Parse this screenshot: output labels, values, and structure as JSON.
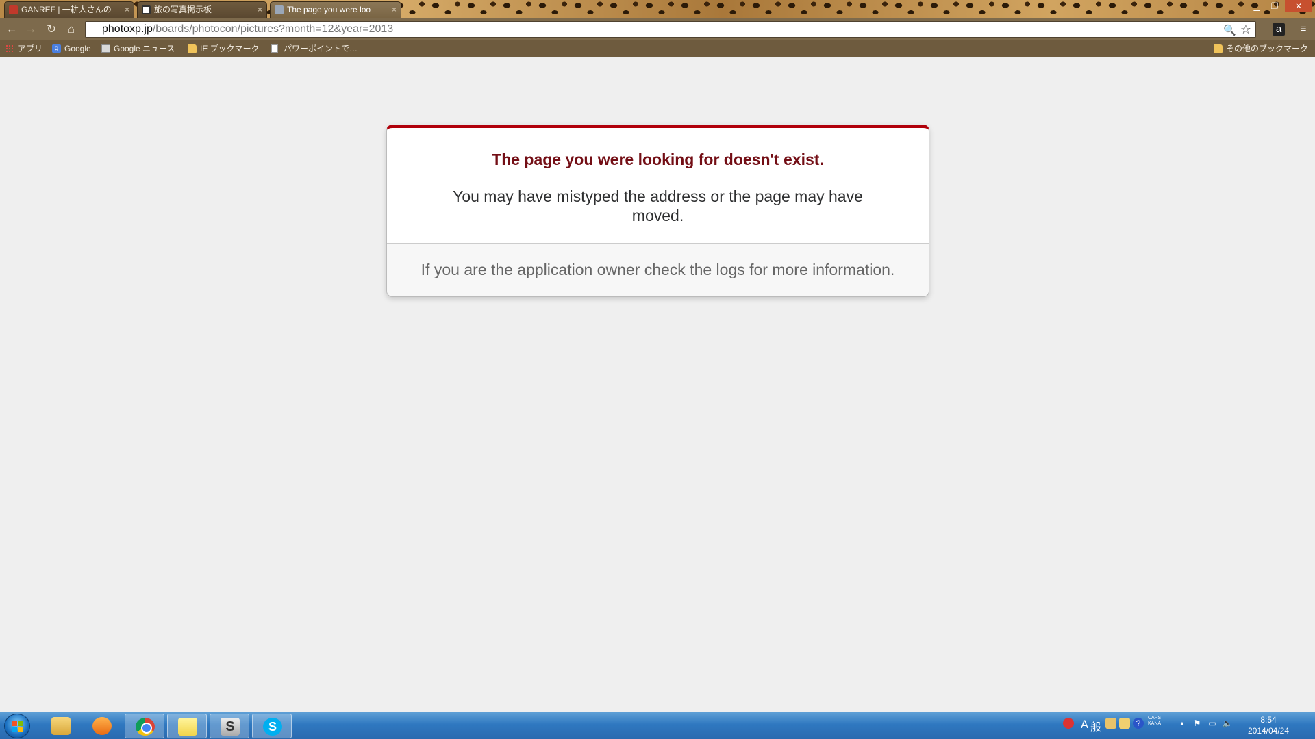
{
  "browser": {
    "tabs": [
      {
        "title": "GANREF | 一耕人さんの",
        "favicon": "camera-icon",
        "active": false
      },
      {
        "title": "旅の写真掲示板",
        "favicon": "camera-icon",
        "active": false
      },
      {
        "title": "The page you were loo",
        "favicon": "page-icon",
        "active": true
      }
    ],
    "tab_close_glyph": "×",
    "window_controls": {
      "minimize": "▁",
      "restore": "❐",
      "close": "✕"
    },
    "nav": {
      "back": "←",
      "forward": "→",
      "reload": "↻",
      "home": "⌂"
    },
    "url": {
      "host": "photoxp.jp",
      "path": "/boards/photocon/pictures?month=12&year=2013"
    },
    "omnibox_icons": {
      "zoom": "🔍",
      "star": "☆"
    },
    "extensions": {
      "amazon": "a",
      "menu": "≡"
    }
  },
  "bookmarks": {
    "items": [
      {
        "label": "アプリ",
        "icon": "apps-icon"
      },
      {
        "label": "Google",
        "icon": "google-icon"
      },
      {
        "label": "Google ニュース",
        "icon": "news-icon"
      },
      {
        "label": "IE ブックマーク",
        "icon": "folder-icon"
      },
      {
        "label": "パワーポイントで…",
        "icon": "page-icon"
      }
    ],
    "other": "その他のブックマーク"
  },
  "page": {
    "heading": "The page you were looking for doesn't exist.",
    "description": "You may have mistyped the address or the page may have moved.",
    "footer": "If you are the application owner check the logs for more information.",
    "accent_color": "#b0000a",
    "heading_color": "#730e15"
  },
  "taskbar": {
    "apps": [
      "explorer-icon",
      "media-player-icon",
      "chrome-icon",
      "sticky-notes-icon",
      "s-app-icon",
      "skype-icon"
    ],
    "s_app_glyph": "S",
    "skype_glyph": "S",
    "ime": {
      "mode": "A",
      "dict": "般"
    },
    "tray_glyphs": {
      "caps": "CAPS",
      "kana": "KANA",
      "help": "?",
      "arrow": "▲",
      "flag": "⚑",
      "network": "▭",
      "volume": "🔈"
    },
    "clock": {
      "time": "8:54",
      "date": "2014/04/24"
    }
  }
}
